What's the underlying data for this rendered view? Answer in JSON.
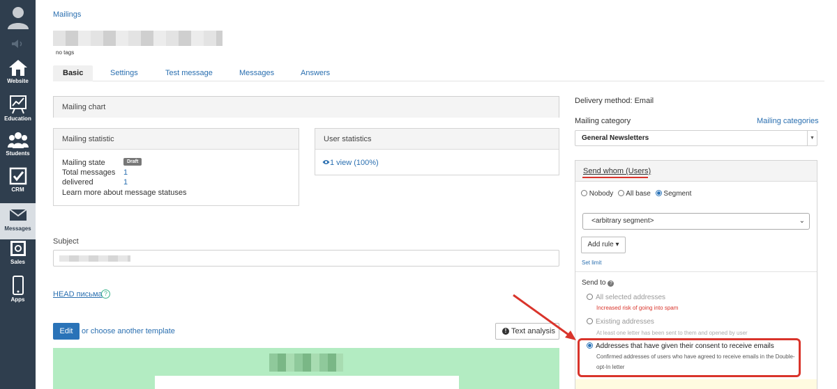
{
  "sidebar": {
    "items": [
      {
        "label": "Website",
        "icon": "house-icon"
      },
      {
        "label": "Education",
        "icon": "chart-board-icon"
      },
      {
        "label": "Students",
        "icon": "users-icon"
      },
      {
        "label": "CRM",
        "icon": "checkbox-icon"
      },
      {
        "label": "Messages",
        "icon": "envelope-icon",
        "active": true
      },
      {
        "label": "Sales",
        "icon": "safe-icon"
      },
      {
        "label": "Apps",
        "icon": "phone-icon"
      }
    ]
  },
  "breadcrumb": "Mailings",
  "tags_text": "no tags",
  "tabs": [
    "Basic",
    "Settings",
    "Test message",
    "Messages",
    "Answers"
  ],
  "mailing_chart": {
    "title": "Mailing chart"
  },
  "mailing_statistic": {
    "title": "Mailing statistic",
    "state_label": "Mailing state",
    "state_badge": "Draft",
    "total_label": "Total messages",
    "total_value": "1",
    "delivered_label": "delivered",
    "delivered_value": "1",
    "learn_more": "Learn more about message statuses"
  },
  "user_statistics": {
    "title": "User statistics",
    "views": "1 view (100%)"
  },
  "subject": {
    "label": "Subject"
  },
  "head_link": "HEAD письма",
  "help_mark": "?",
  "editor": {
    "edit_label": "Edit",
    "choose_template": "or choose another template",
    "text_analysis": "Text analysis"
  },
  "delivery_method": "Delivery method: Email",
  "mailing_category": {
    "label": "Mailing category",
    "link": "Mailing categories",
    "value": "General Newsletters"
  },
  "send_whom": {
    "title": "Send whom (Users)",
    "options": [
      "Nobody",
      "All base",
      "Segment"
    ],
    "selected": "Segment",
    "segment_value": "<arbitrary segment>",
    "add_rule": "Add rule",
    "set_limit": "Set limit"
  },
  "send_to": {
    "label": "Send to",
    "options": [
      {
        "label": "All selected addresses",
        "desc": "Increased risk of going into spam"
      },
      {
        "label": "Existing addresses",
        "desc": "At least one letter has been sent to them and opened by user"
      },
      {
        "label": "Addresses that have given their consent to receive emails",
        "desc": "Confirmed addresses of users who have agreed to receive emails in the Double-opt-In letter"
      }
    ],
    "selected": 2
  },
  "colors": {
    "sidebar_bg": "#2f3e4e",
    "link": "#2a6fb0",
    "highlight": "#d9342b",
    "preview_bg": "#b3ecc2"
  }
}
